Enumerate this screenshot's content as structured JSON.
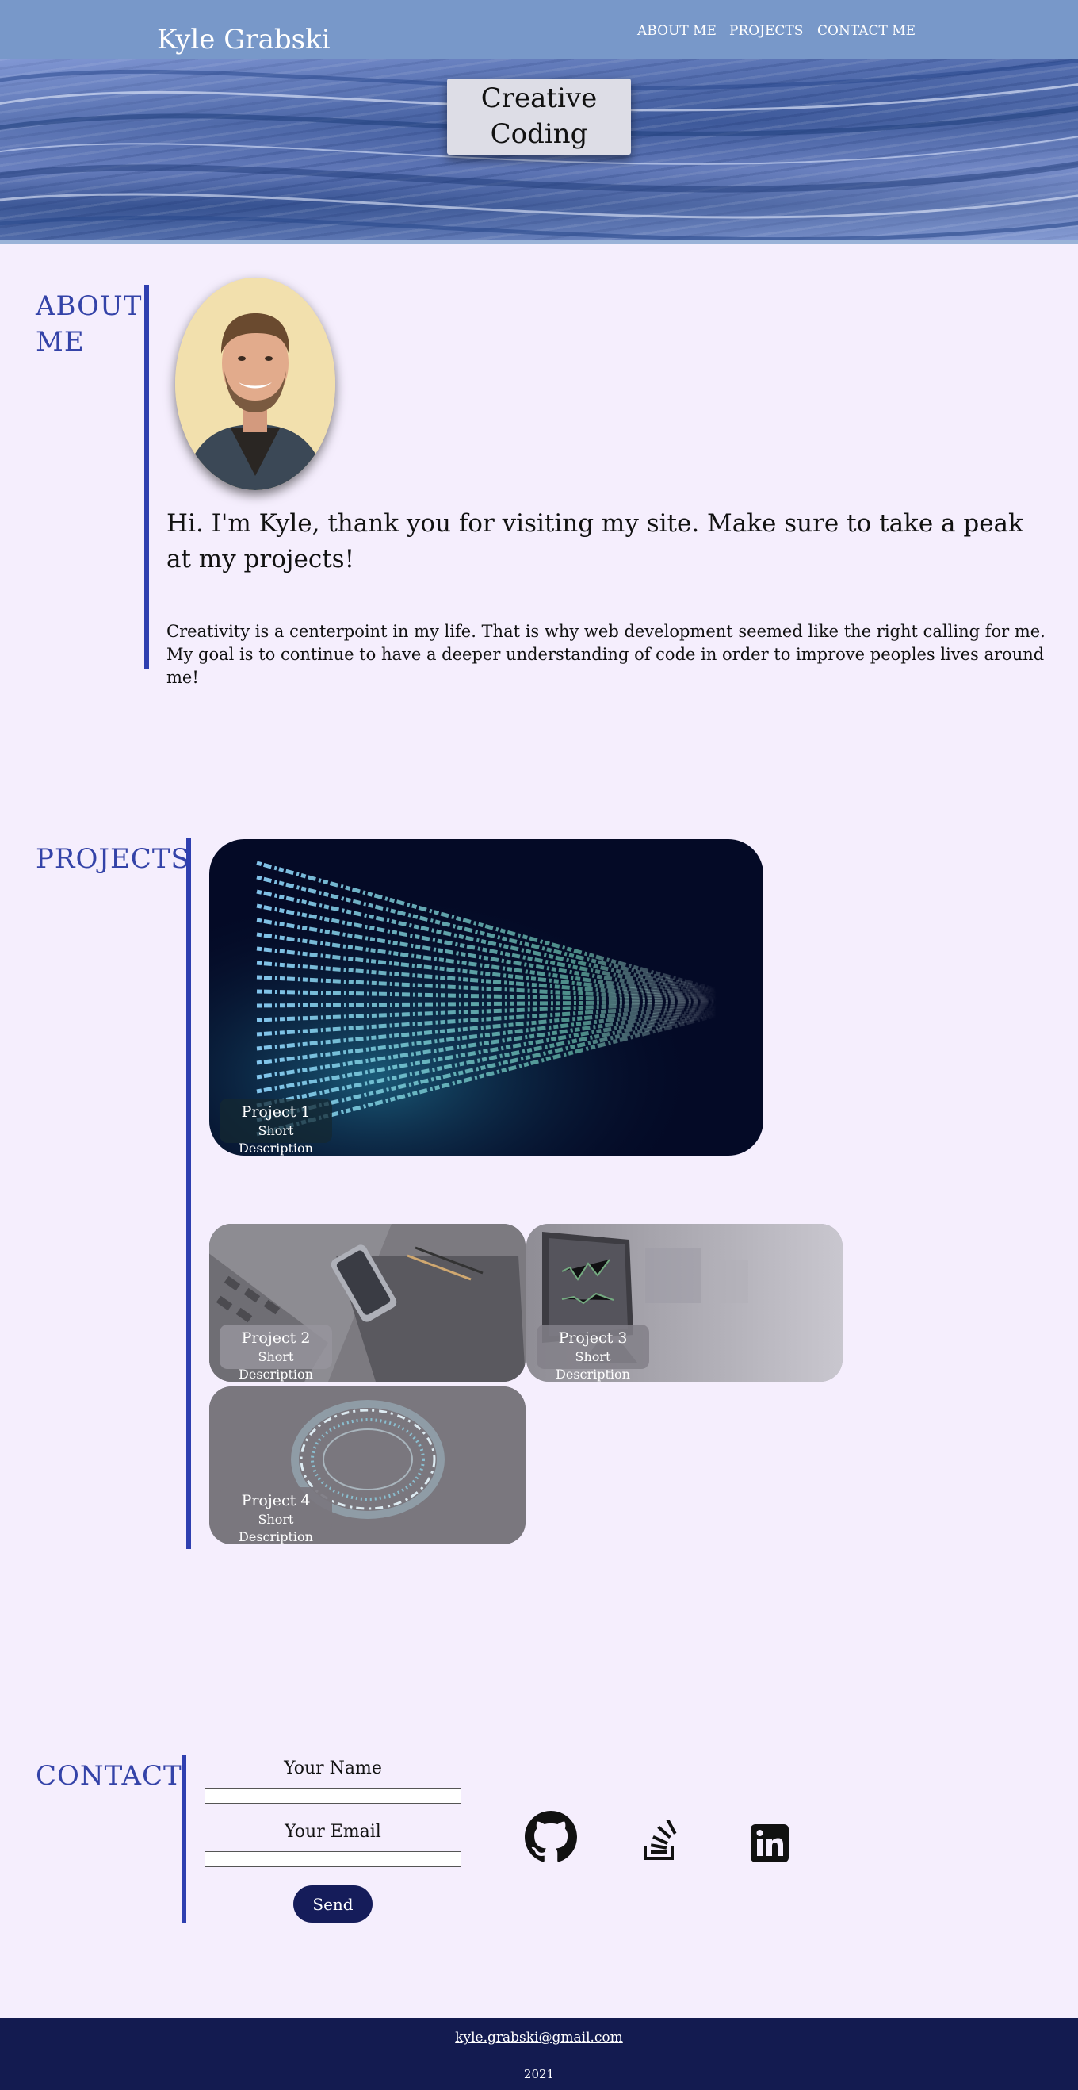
{
  "header": {
    "site_title": "Kyle Grabski",
    "nav": [
      {
        "label": "ABOUT ME"
      },
      {
        "label": "PROJECTS"
      },
      {
        "label": "CONTACT ME"
      }
    ]
  },
  "hero": {
    "card_line1": "Creative",
    "card_line2": "Coding"
  },
  "about": {
    "title_line1": "ABOUT",
    "title_line2": "ME",
    "greeting": "Hi. I'm Kyle, thank you for visiting my site. Make sure to take a peak at my projects!",
    "body": "Creativity is a centerpoint in my life. That is why web development seemed like the right calling for me. My goal is to continue to have a deeper understanding of code in order to improve peoples lives around me!"
  },
  "projects": {
    "title": "PROJECTS",
    "items": [
      {
        "name": "Project 1",
        "description": "Short Description"
      },
      {
        "name": "Project 2",
        "description": "Short Description"
      },
      {
        "name": "Project 3",
        "description": "Short Description"
      },
      {
        "name": "Project 4",
        "description": "Short Description"
      }
    ]
  },
  "contact": {
    "title": "CONTACT",
    "name_label": "Your Name",
    "name_value": "",
    "email_label": "Your Email",
    "email_value": "",
    "send_label": "Send",
    "social_icons": [
      "github-icon",
      "stackoverflow-icon",
      "linkedin-icon"
    ]
  },
  "footer": {
    "email": "kyle.grabski@gmail.com",
    "year": "2021"
  },
  "colors": {
    "topbar": "#7898c9",
    "page_background": "#f5eefd",
    "accent_blue": "#2f3fb0",
    "section_title": "#3443a8",
    "footer": "#131b50",
    "send_button": "#151c5a"
  }
}
